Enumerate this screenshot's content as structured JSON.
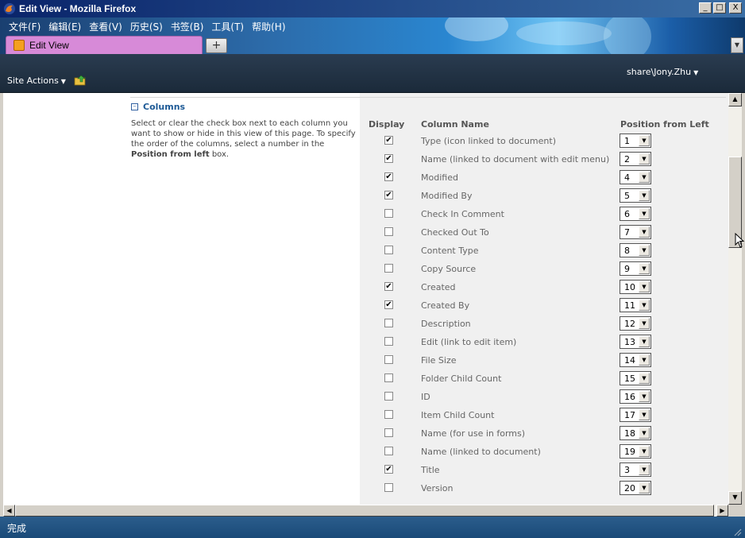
{
  "window": {
    "title": "Edit View - Mozilla Firefox",
    "buttons": [
      "_",
      "□",
      "X"
    ]
  },
  "menubar": [
    "文件(F)",
    "编辑(E)",
    "查看(V)",
    "历史(S)",
    "书签(B)",
    "工具(T)",
    "帮助(H)"
  ],
  "tabs": [
    {
      "label": "Edit View"
    }
  ],
  "new_tab_label": "+",
  "sharepoint": {
    "site_actions_label": "Site Actions",
    "user_label": "share\\Jony.Zhu"
  },
  "section": {
    "title": "Columns",
    "description_pre": "Select or clear the check box next to each column you want to show or hide in this view of this page. To specify the order of the columns, select a number in the ",
    "description_bold": "Position from left",
    "description_post": " box."
  },
  "table": {
    "headers": {
      "display": "Display",
      "column_name": "Column Name",
      "position": "Position from Left"
    },
    "rows": [
      {
        "checked": true,
        "name": "Type (icon linked to document)",
        "position": "1"
      },
      {
        "checked": true,
        "name": "Name (linked to document with edit menu)",
        "position": "2"
      },
      {
        "checked": true,
        "name": "Modified",
        "position": "4"
      },
      {
        "checked": true,
        "name": "Modified By",
        "position": "5"
      },
      {
        "checked": false,
        "name": "Check In Comment",
        "position": "6"
      },
      {
        "checked": false,
        "name": "Checked Out To",
        "position": "7"
      },
      {
        "checked": false,
        "name": "Content Type",
        "position": "8"
      },
      {
        "checked": false,
        "name": "Copy Source",
        "position": "9"
      },
      {
        "checked": true,
        "name": "Created",
        "position": "10"
      },
      {
        "checked": true,
        "name": "Created By",
        "position": "11"
      },
      {
        "checked": false,
        "name": "Description",
        "position": "12"
      },
      {
        "checked": false,
        "name": "Edit (link to edit item)",
        "position": "13"
      },
      {
        "checked": false,
        "name": "File Size",
        "position": "14"
      },
      {
        "checked": false,
        "name": "Folder Child Count",
        "position": "15"
      },
      {
        "checked": false,
        "name": "ID",
        "position": "16"
      },
      {
        "checked": false,
        "name": "Item Child Count",
        "position": "17"
      },
      {
        "checked": false,
        "name": "Name (for use in forms)",
        "position": "18"
      },
      {
        "checked": false,
        "name": "Name (linked to document)",
        "position": "19"
      },
      {
        "checked": true,
        "name": "Title",
        "position": "3"
      },
      {
        "checked": false,
        "name": "Version",
        "position": "20"
      }
    ]
  },
  "status": {
    "text": "完成"
  },
  "icons": {
    "browser": "firefox-icon",
    "tab": "sharepoint-page-icon",
    "folder": "folder-up-icon",
    "collapse": "collapse-minus-icon"
  }
}
